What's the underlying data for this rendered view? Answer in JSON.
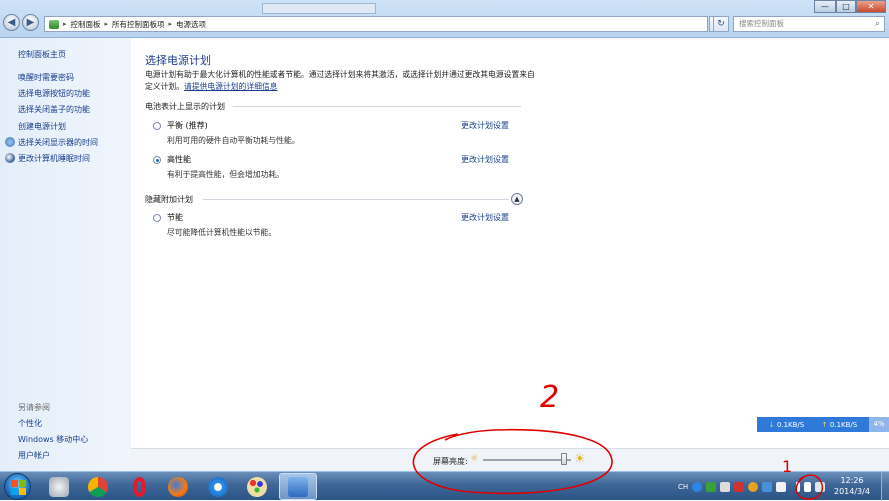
{
  "window": {
    "nav_back": "◀",
    "nav_forward": "▶",
    "breadcrumb": [
      "控制面板",
      "所有控制面板项",
      "电源选项"
    ],
    "refresh_glyph": "↻",
    "search_placeholder": "搜索控制面板",
    "controls": [
      "—",
      "□",
      "✕"
    ]
  },
  "sidebar": {
    "home": "控制面板主页",
    "items": [
      "唤醒时需要密码",
      "选择电源按钮的功能",
      "选择关闭盖子的功能",
      "创建电源计划",
      "选择关闭显示器的时间",
      "更改计算机睡眠时间"
    ],
    "see_also_label": "另请参阅",
    "see_also": [
      "个性化",
      "Windows 移动中心",
      "用户帐户"
    ]
  },
  "main": {
    "title": "选择电源计划",
    "description_text": "电源计划有助于最大化计算机的性能或者节能。通过选择计划来将其激活，或选择计划并通过更改其电源设置来自定义计划。",
    "description_link": "请提供电源计划的详细信息",
    "section_shown": "电池表计上显示的计划",
    "section_hidden": "隐藏附加计划",
    "plans": [
      {
        "name": "平衡 (推荐)",
        "desc": "利用可用的硬件自动平衡功耗与性能。",
        "link": "更改计划设置",
        "selected": false
      },
      {
        "name": "高性能",
        "desc": "有利于提高性能，但会增加功耗。",
        "link": "更改计划设置",
        "selected": true
      },
      {
        "name": "节能",
        "desc": "尽可能降低计算机性能以节能。",
        "link": "更改计划设置",
        "selected": false
      }
    ]
  },
  "brightness": {
    "label": "屏幕亮度:",
    "level": 0.92
  },
  "network_widget": {
    "down": "0.1KB/S",
    "up": "0.1KB/S",
    "percent": "4%"
  },
  "taskbar": {
    "apps": [
      "chess",
      "chrome",
      "opera",
      "firefox",
      "ie",
      "paint",
      "control-panel"
    ],
    "language": "CH",
    "time": "12:26",
    "date": "2014/3/4"
  },
  "annotations": {
    "label_1": "1",
    "label_2": "2",
    "color": "#e00000"
  },
  "colors": {
    "link": "#1a3e8c",
    "title": "#1e3f8f",
    "taskbar": "#2b5487",
    "widget": "#2f7ad8"
  }
}
